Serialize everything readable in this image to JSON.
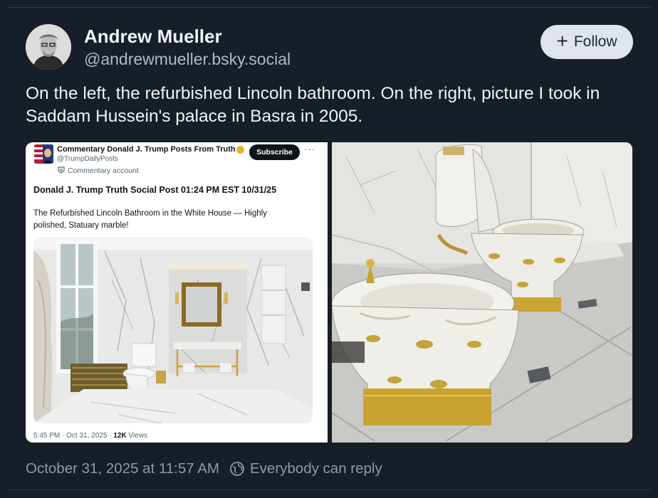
{
  "post": {
    "author_name": "Andrew Mueller",
    "author_handle": "@andrewmueller.bsky.social",
    "follow_label": "Follow",
    "text": "On the left, the refurbished Lincoln bathroom. On the right, picture I took in Saddam Hussein's palace in Basra in 2005.",
    "timestamp": "October 31, 2025 at 11:57 AM",
    "reply_setting": "Everybody can reply"
  },
  "embedded_tweet": {
    "account_name": "Commentary Donald J. Trump Posts From Truth ...",
    "handle": "@TrumpDailyPosts",
    "subscribe_label": "Subscribe",
    "more": "···",
    "account_type": "Commentary account",
    "headline_bold": "Donald J. Trump Truth Social Post",
    "headline_time": " 01:24 PM EST 10/31/25",
    "body": "The Refurbished Lincoln Bathroom in the White House — Highly polished, Statuary marble!",
    "footer_meta": "5:45 PM · Oct 31, 2025 · ",
    "views_count": "12K",
    "views_label": " Views"
  },
  "icons": {
    "follow": "plus-icon",
    "reply": "globe-icon",
    "verified": "verified-badge-icon"
  },
  "colors": {
    "background": "#161e27",
    "follow_button": "#dfe5ea",
    "muted_text": "#8d9aa8"
  }
}
